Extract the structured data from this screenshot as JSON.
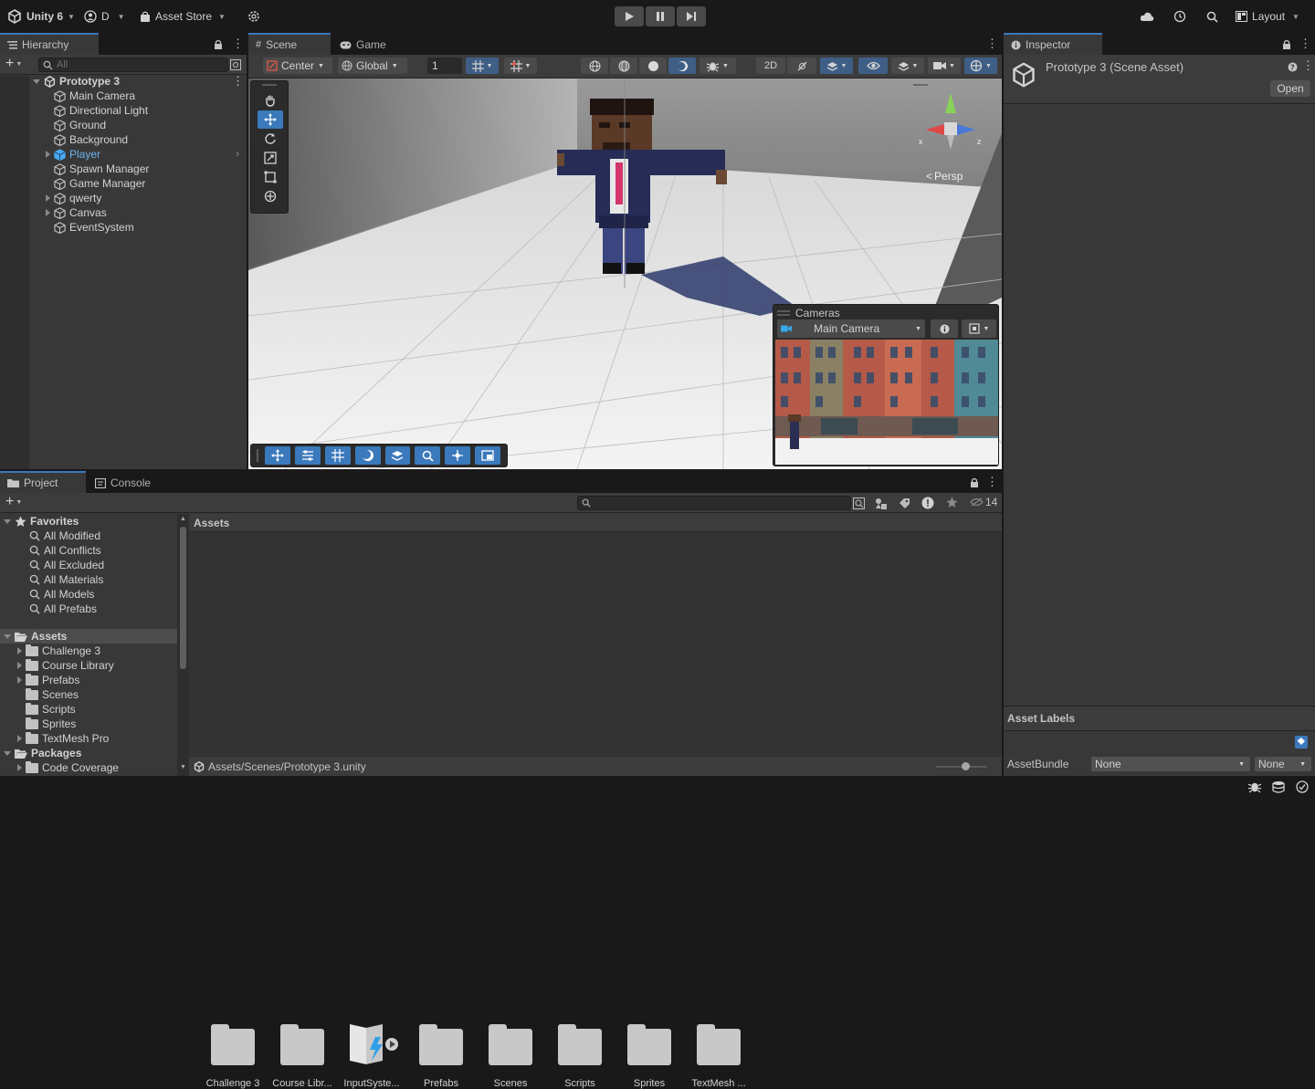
{
  "topbar": {
    "app_name": "Unity 6",
    "account": "D",
    "asset_store": "Asset Store",
    "layout": "Layout"
  },
  "hierarchy": {
    "tab": "Hierarchy",
    "search_placeholder": "All",
    "scene": "Prototype 3",
    "items": [
      {
        "label": "Main Camera",
        "expandable": false
      },
      {
        "label": "Directional Light",
        "expandable": false
      },
      {
        "label": "Ground",
        "expandable": false
      },
      {
        "label": "Background",
        "expandable": false
      },
      {
        "label": "Player",
        "expandable": true
      },
      {
        "label": "Spawn Manager",
        "expandable": false
      },
      {
        "label": "Game Manager",
        "expandable": false
      },
      {
        "label": "qwerty",
        "expandable": true
      },
      {
        "label": "Canvas",
        "expandable": true
      },
      {
        "label": "EventSystem",
        "expandable": false
      }
    ]
  },
  "scene": {
    "tabs": [
      "Scene",
      "Game"
    ],
    "pivot": "Center",
    "space": "Global",
    "grid_value": "1",
    "view_2d": "2D",
    "persp": "Persp",
    "axis_x": "x",
    "axis_z": "z"
  },
  "cameras_overlay": {
    "title": "Cameras",
    "selected": "Main Camera"
  },
  "inspector": {
    "tab": "Inspector",
    "title": "Prototype 3 (Scene Asset)",
    "open_button": "Open",
    "asset_labels": "Asset Labels",
    "asset_bundle_label": "AssetBundle",
    "asset_bundle_value": "None",
    "asset_bundle_variant": "None"
  },
  "project": {
    "tabs": [
      "Project",
      "Console"
    ],
    "hidden_count": "14",
    "favorites_header": "Favorites",
    "favorites": [
      "All Modified",
      "All Conflicts",
      "All Excluded",
      "All Materials",
      "All Models",
      "All Prefabs"
    ],
    "assets_header": "Assets",
    "asset_tree": [
      {
        "label": "Challenge 3",
        "expandable": true
      },
      {
        "label": "Course Library",
        "expandable": true
      },
      {
        "label": "Prefabs",
        "expandable": true
      },
      {
        "label": "Scenes",
        "expandable": false
      },
      {
        "label": "Scripts",
        "expandable": false
      },
      {
        "label": "Sprites",
        "expandable": false
      },
      {
        "label": "TextMesh Pro",
        "expandable": true
      }
    ],
    "packages_header": "Packages",
    "packages": [
      {
        "label": "Code Coverage",
        "expandable": true
      }
    ],
    "breadcrumb": "Assets",
    "grid_items": [
      "Challenge 3",
      "Course Libr...",
      "InputSyste...",
      "Prefabs",
      "Scenes",
      "Scripts",
      "Sprites",
      "TextMesh ..."
    ],
    "path": "Assets/Scenes/Prototype 3.unity"
  },
  "colors": {
    "accent": "#3a79bb",
    "panel": "#383838",
    "dark": "#191919"
  }
}
